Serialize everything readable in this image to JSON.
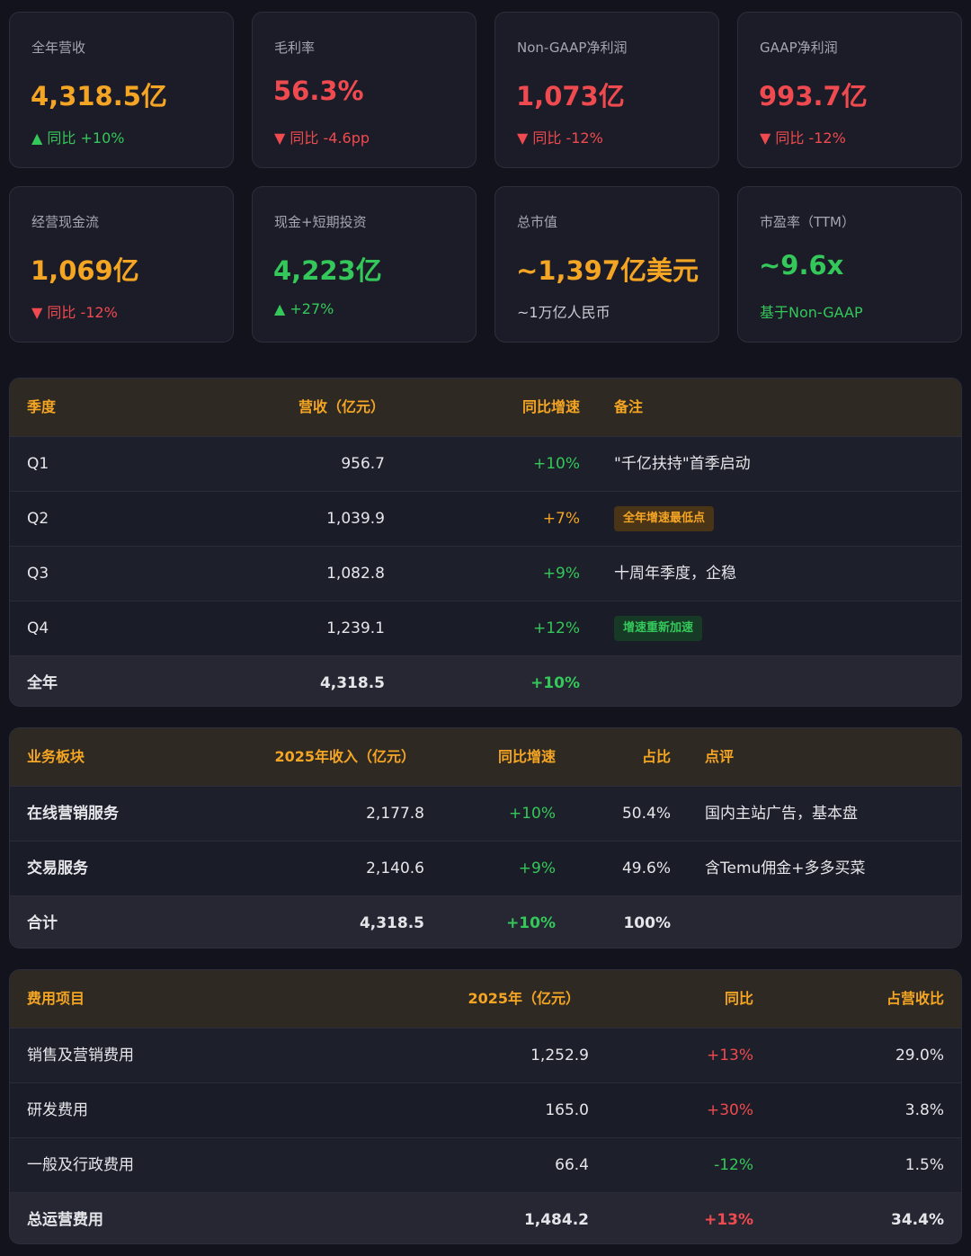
{
  "cards": [
    {
      "label": "全年营收",
      "value": "4,318.5亿",
      "change": "▲ 同比 +10%"
    },
    {
      "label": "毛利率",
      "value": "56.3%",
      "change": "▼ 同比 -4.6pp"
    },
    {
      "label": "Non-GAAP净利润",
      "value": "1,073亿",
      "change": "▼ 同比 -12%"
    },
    {
      "label": "GAAP净利润",
      "value": "993.7亿",
      "change": "▼ 同比 -12%"
    },
    {
      "label": "经营现金流",
      "value": "1,069亿",
      "change": "▼ 同比 -12%"
    },
    {
      "label": "现金+短期投资",
      "value": "4,223亿",
      "change": "▲ +27%"
    },
    {
      "label": "总市值",
      "value": "~1,397亿美元",
      "change": "~1万亿人民币"
    },
    {
      "label": "市盈率（TTM）",
      "value": "~9.6x",
      "change": "基于Non-GAAP"
    }
  ],
  "colors": {
    "orange": "#f5a524",
    "red": "#ef4a4f",
    "green": "#34c759",
    "background": "#12131c",
    "card": "#1b1c27"
  },
  "quarterly": {
    "headers": [
      "季度",
      "营收（亿元）",
      "同比增速",
      "备注"
    ],
    "rows": [
      {
        "q": "Q1",
        "rev": "956.7",
        "yoy": "+10%",
        "note": "\"千亿扶持\"首季启动"
      },
      {
        "q": "Q2",
        "rev": "1,039.9",
        "yoy": "+7%",
        "note": "全年增速最低点"
      },
      {
        "q": "Q3",
        "rev": "1,082.8",
        "yoy": "+9%",
        "note": "十周年季度，企稳"
      },
      {
        "q": "Q4",
        "rev": "1,239.1",
        "yoy": "+12%",
        "note": "增速重新加速"
      },
      {
        "q": "全年",
        "rev": "4,318.5",
        "yoy": "+10%",
        "note": ""
      }
    ]
  },
  "segments": {
    "headers": [
      "业务板块",
      "2025年收入（亿元）",
      "同比增速",
      "占比",
      "点评"
    ],
    "rows": [
      {
        "name": "在线营销服务",
        "rev": "2,177.8",
        "yoy": "+10%",
        "share": "50.4%",
        "comment": "国内主站广告，基本盘"
      },
      {
        "name": "交易服务",
        "rev": "2,140.6",
        "yoy": "+9%",
        "share": "49.6%",
        "comment": "含Temu佣金+多多买菜"
      },
      {
        "name": "合计",
        "rev": "4,318.5",
        "yoy": "+10%",
        "share": "100%",
        "comment": ""
      }
    ]
  },
  "expenses": {
    "headers": [
      "费用项目",
      "2025年（亿元）",
      "同比",
      "占营收比"
    ],
    "rows": [
      {
        "item": "销售及营销费用",
        "amt": "1,252.9",
        "yoy": "+13%",
        "pct": "29.0%"
      },
      {
        "item": "研发费用",
        "amt": "165.0",
        "yoy": "+30%",
        "pct": "3.8%"
      },
      {
        "item": "一般及行政费用",
        "amt": "66.4",
        "yoy": "-12%",
        "pct": "1.5%"
      },
      {
        "item": "总运营费用",
        "amt": "1,484.2",
        "yoy": "+13%",
        "pct": "34.4%"
      }
    ]
  }
}
